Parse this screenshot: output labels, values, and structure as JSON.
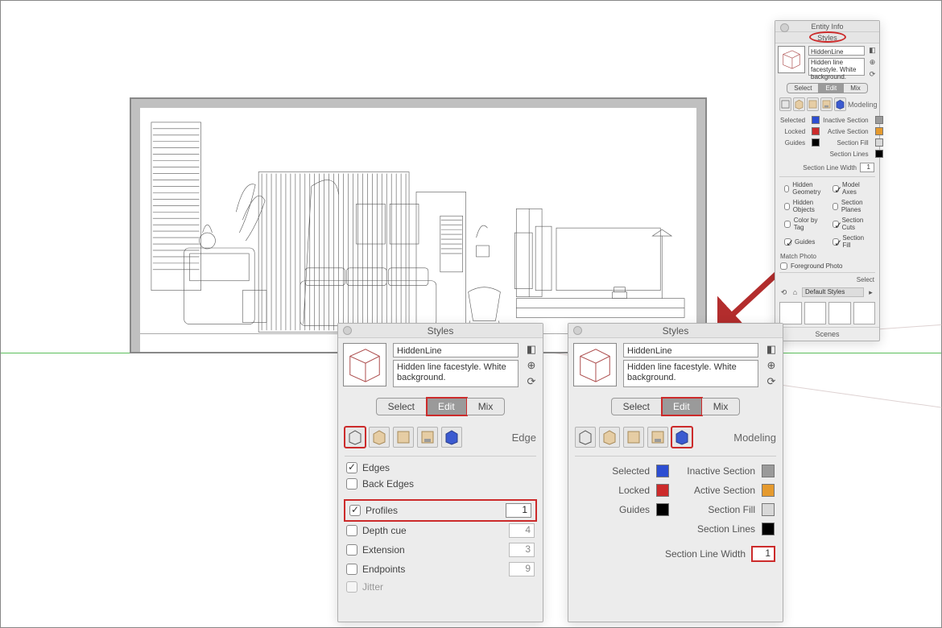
{
  "titles": {
    "entity_info": "Entity Info",
    "styles": "Styles",
    "scenes": "Scenes"
  },
  "style": {
    "name": "HiddenLine",
    "description": "Hidden line facestyle. White background."
  },
  "tabs": {
    "select": "Select",
    "edit": "Edit",
    "mix": "Mix"
  },
  "edit_labels": {
    "edge": "Edge",
    "modeling": "Modeling"
  },
  "edge_settings": {
    "edges": {
      "label": "Edges",
      "checked": true
    },
    "back_edges": {
      "label": "Back Edges",
      "checked": false
    },
    "profiles": {
      "label": "Profiles",
      "checked": true,
      "value": "1"
    },
    "depth_cue": {
      "label": "Depth cue",
      "checked": false,
      "value": "4"
    },
    "extension": {
      "label": "Extension",
      "checked": false,
      "value": "3"
    },
    "endpoints": {
      "label": "Endpoints",
      "checked": false,
      "value": "9"
    },
    "jitter": {
      "label": "Jitter",
      "checked": false
    }
  },
  "modeling": {
    "selected": "Selected",
    "locked": "Locked",
    "guides": "Guides",
    "inactive_section": "Inactive Section",
    "active_section": "Active Section",
    "section_fill": "Section Fill",
    "section_lines": "Section Lines",
    "section_line_width": {
      "label": "Section Line Width",
      "value": "1"
    }
  },
  "checkboxes": {
    "hidden_geometry": "Hidden Geometry",
    "hidden_objects": "Hidden Objects",
    "color_by_tag": "Color by Tag",
    "guides_cb": "Guides",
    "model_axes": "Model Axes",
    "section_planes": "Section Planes",
    "section_cuts": "Section Cuts",
    "section_fill_cb": "Section Fill",
    "match_photo": "Match Photo",
    "foreground_photo": "Foreground Photo"
  },
  "browser": {
    "select_label": "Select",
    "default_styles": "Default Styles"
  }
}
